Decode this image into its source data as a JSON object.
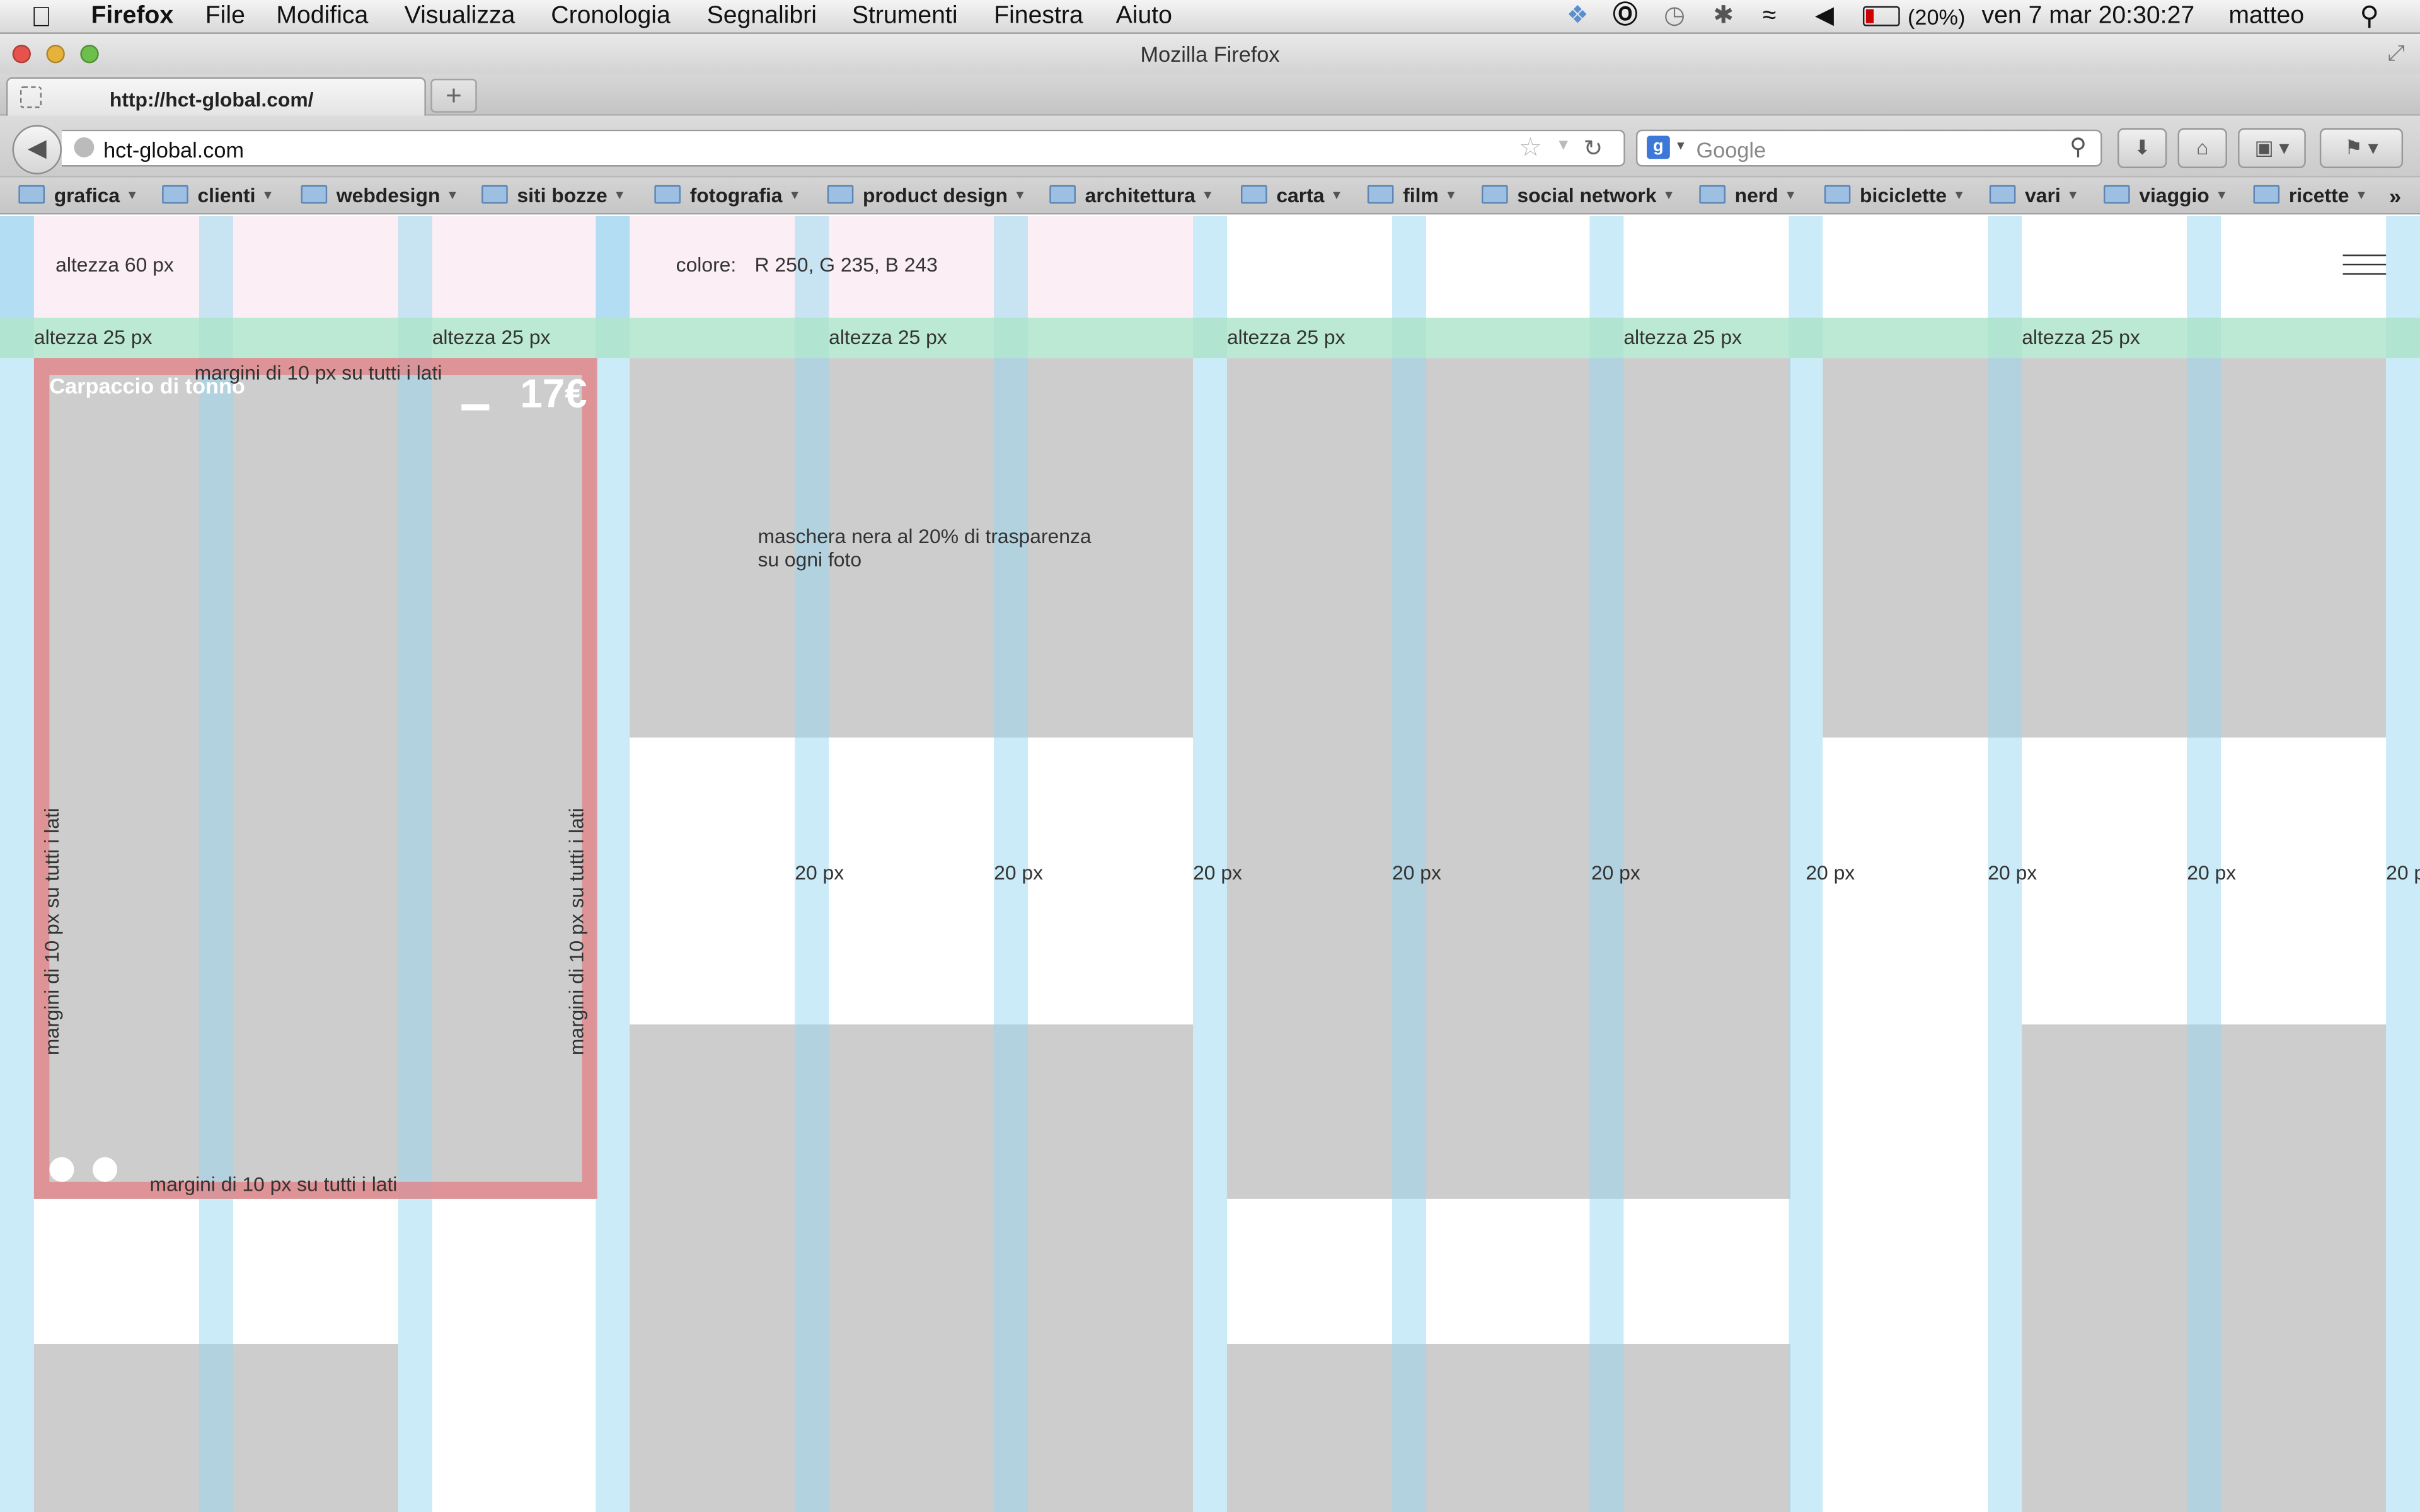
{
  "menubar": {
    "apple": "",
    "app": "Firefox",
    "items": [
      "File",
      "Modifica",
      "Visualizza",
      "Cronologia",
      "Segnalibri",
      "Strumenti",
      "Finestra",
      "Aiuto"
    ],
    "battery": "(20%)",
    "clock": "ven 7 mar  20:30:27",
    "user": "matteo"
  },
  "window": {
    "title": "Mozilla Firefox"
  },
  "tab": {
    "label": "http://hct-global.com/"
  },
  "navbar": {
    "url": "hct-global.com",
    "search_placeholder": "Google"
  },
  "bookmarks": [
    "grafica",
    "clienti",
    "webdesign",
    "siti bozze",
    "fotografia",
    "product design",
    "architettura",
    "carta",
    "film",
    "social network",
    "nerd",
    "biciclette",
    "vari",
    "viaggio",
    "ricette"
  ],
  "page": {
    "header_height_label": "altezza 60 px",
    "color_label": "colore:",
    "color_value": "R 250, G 235, B 243",
    "band_label": "altezza 25 px",
    "card_title": "Carpaccio di tonno",
    "card_price": "17€",
    "margin_label": "margini di 10 px su tutti i lati",
    "mask_note_1": "maschera nera al 20% di trasparenza",
    "mask_note_2": "su ogni foto",
    "gutter_label": "20 px",
    "gutter_label_cut": "20 p"
  },
  "colors": {
    "header_pink": "#FAEBF3",
    "gutter_blue": "#CFEAF7",
    "band_green": "#AAE4C8",
    "photo_gray": "#CDCDCD",
    "margin_red": "#E2848A"
  }
}
